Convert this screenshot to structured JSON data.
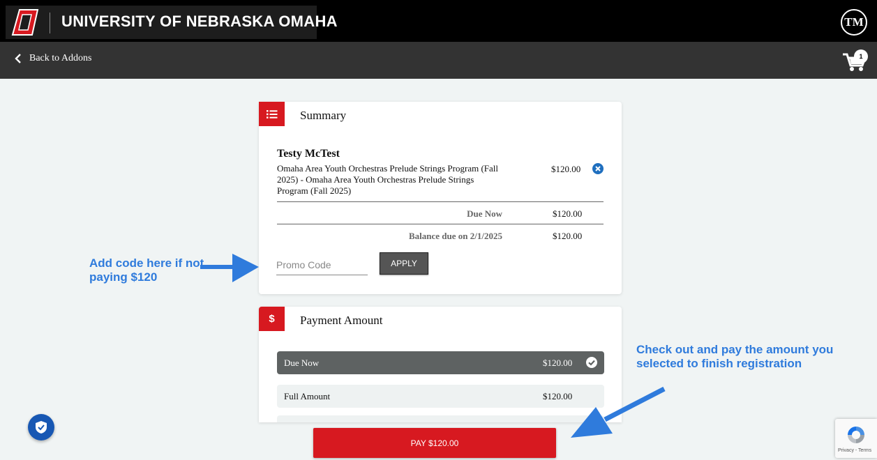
{
  "header": {
    "university_name": "UNIVERSITY OF NEBRASKA OMAHA",
    "user_initials": "TM"
  },
  "nav": {
    "back_label": "Back to Addons",
    "cart_count": "1"
  },
  "summary": {
    "title": "Summary",
    "icon": "list-icon",
    "registrant_name": "Testy McTest",
    "item_description": "Omaha Area Youth Orchestras Prelude Strings Program (Fall 2025) - Omaha Area Youth Orchestras Prelude Strings Program (Fall 2025)",
    "item_price": "$120.00",
    "due_now_label": "Due Now",
    "due_now_value": "$120.00",
    "balance_label": "Balance due on 2/1/2025",
    "balance_value": "$120.00",
    "promo_placeholder": "Promo Code",
    "promo_value": "",
    "apply_label": "APPLY"
  },
  "payment": {
    "title": "Payment Amount",
    "icon_symbol": "$",
    "options": [
      {
        "label": "Due Now",
        "value": "$120.00",
        "selected": true
      },
      {
        "label": "Full Amount",
        "value": "$120.00",
        "selected": false
      }
    ],
    "pay_button_label": "PAY $120.00"
  },
  "annotations": {
    "left_text": "Add code here if not paying $120",
    "right_text": "Check out and pay the amount you selected to finish registration"
  },
  "recaptcha": {
    "footer_text": "Privacy - Terms"
  },
  "colors": {
    "brand_red": "#d71920",
    "annotation_blue": "#2f7bdc",
    "selected_option": "#5e6262",
    "shield_blue": "#1757b3"
  }
}
